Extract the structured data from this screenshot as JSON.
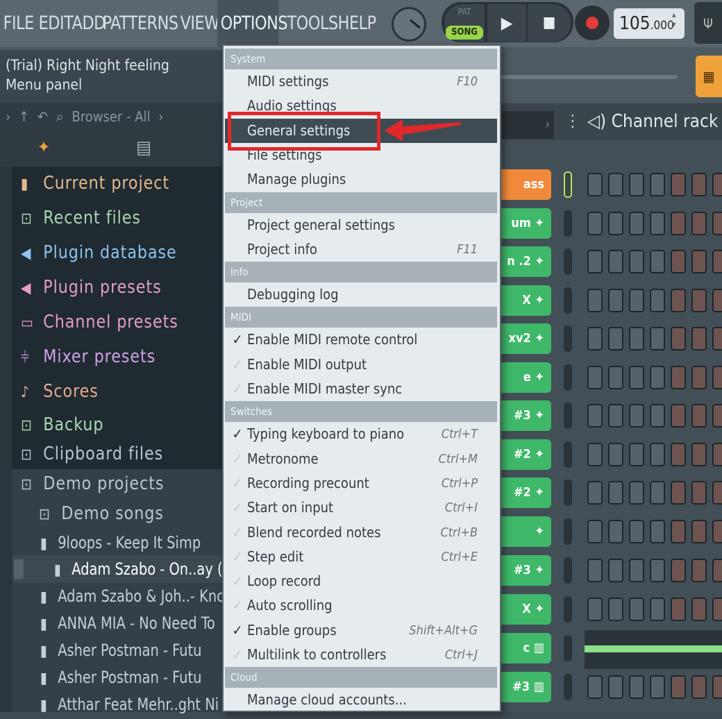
{
  "menubar": {
    "items": [
      "FILE",
      "EDIT",
      "ADD",
      "PATTERNS",
      "VIEW",
      "OPTIONS",
      "TOOLS",
      "HELP"
    ],
    "active": "OPTIONS"
  },
  "transport": {
    "pat_label": "PAT",
    "song_label": "SONG",
    "play_icon": "▶",
    "stop_icon": "■",
    "tempo_main": "105",
    "tempo_frac": ".000"
  },
  "hint": {
    "line1": "(Trial) Right Night feeling",
    "line2": "Menu panel"
  },
  "browser": {
    "toolbar_label": "Browser - All",
    "items": [
      {
        "label": "Current project",
        "icon": "page-icon",
        "color": "#e4b98b"
      },
      {
        "label": "Recent files",
        "icon": "folder-icon",
        "color": "#a9d7b0"
      },
      {
        "label": "Plugin database",
        "icon": "speaker-icon",
        "color": "#8ec3ee"
      },
      {
        "label": "Plugin presets",
        "icon": "speaker-icon",
        "color": "#e59fc4"
      },
      {
        "label": "Channel presets",
        "icon": "channel-icon",
        "color": "#e59fc4"
      },
      {
        "label": "Mixer presets",
        "icon": "mixer-icon",
        "color": "#d0a0e6"
      },
      {
        "label": "Scores",
        "icon": "note-icon",
        "color": "#e7a88e"
      },
      {
        "label": "Backup",
        "icon": "folder-icon",
        "color": "#a9d7b0"
      },
      {
        "label": "Clipboard files",
        "icon": "folder-icon",
        "color": "#b7c6d0"
      },
      {
        "label": "Demo projects",
        "icon": "folder-icon",
        "color": "#b7c6d0"
      },
      {
        "label": "Demo songs",
        "icon": "folder-icon",
        "color": "#b7c6d0"
      }
    ],
    "files": [
      "9loops - Keep It Simp",
      "Adam Szabo - On..ay (",
      "Adam Szabo & Joh..- Knc",
      "ANNA MIA - No Need To",
      "Asher Postman - Futu",
      "Asher Postman - Futu",
      "Atthar Feat Mehr..ght Ni"
    ]
  },
  "channel_rack": {
    "title": "Channel rack",
    "channels": [
      {
        "label": "ass FM",
        "color": "#f08a3a"
      },
      {
        "label": "um",
        "color": "#3fb86a"
      },
      {
        "label": "n .2",
        "color": "#3fb86a"
      },
      {
        "label": "X",
        "color": "#3fb86a"
      },
      {
        "label": "xv2",
        "color": "#3fb86a"
      },
      {
        "label": "e",
        "color": "#3fb86a"
      },
      {
        "label": "#3",
        "color": "#3fb86a"
      },
      {
        "label": "#2",
        "color": "#3fb86a"
      },
      {
        "label": "#2",
        "color": "#3fb86a"
      },
      {
        "label": "",
        "color": "#3fb86a"
      },
      {
        "label": "#3",
        "color": "#3fb86a"
      },
      {
        "label": "X",
        "color": "#3fb86a"
      },
      {
        "label": "c",
        "color": "#3fb86a"
      },
      {
        "label": "#3",
        "color": "#3fb86a"
      }
    ]
  },
  "options_menu": {
    "sections": [
      {
        "header": "System",
        "items": [
          {
            "label": "MIDI settings",
            "shortcut": "F10",
            "check": "none"
          },
          {
            "label": "Audio settings",
            "shortcut": "",
            "check": "none"
          },
          {
            "label": "General settings",
            "shortcut": "",
            "check": "none",
            "highlighted": true
          },
          {
            "label": "File settings",
            "shortcut": "",
            "check": "none"
          },
          {
            "label": "Manage plugins",
            "shortcut": "",
            "check": "none"
          }
        ]
      },
      {
        "header": "Project",
        "items": [
          {
            "label": "Project general settings",
            "shortcut": "",
            "check": "none"
          },
          {
            "label": "Project info",
            "shortcut": "F11",
            "check": "none"
          }
        ]
      },
      {
        "header": "Info",
        "items": [
          {
            "label": "Debugging log",
            "shortcut": "",
            "check": "none"
          }
        ]
      },
      {
        "header": "MIDI",
        "items": [
          {
            "label": "Enable MIDI remote control",
            "shortcut": "",
            "check": "on"
          },
          {
            "label": "Enable MIDI output",
            "shortcut": "",
            "check": "off"
          },
          {
            "label": "Enable MIDI master sync",
            "shortcut": "",
            "check": "off"
          }
        ]
      },
      {
        "header": "Switches",
        "items": [
          {
            "label": "Typing keyboard to piano",
            "shortcut": "Ctrl+T",
            "check": "on"
          },
          {
            "label": "Metronome",
            "shortcut": "Ctrl+M",
            "check": "off"
          },
          {
            "label": "Recording precount",
            "shortcut": "Ctrl+P",
            "check": "off"
          },
          {
            "label": "Start on input",
            "shortcut": "Ctrl+I",
            "check": "off"
          },
          {
            "label": "Blend recorded notes",
            "shortcut": "Ctrl+B",
            "check": "off"
          },
          {
            "label": "Step edit",
            "shortcut": "Ctrl+E",
            "check": "off"
          },
          {
            "label": "Loop record",
            "shortcut": "",
            "check": "off"
          },
          {
            "label": "Auto scrolling",
            "shortcut": "",
            "check": "off"
          },
          {
            "label": "Enable groups",
            "shortcut": "Shift+Alt+G",
            "check": "on"
          },
          {
            "label": "Multilink to controllers",
            "shortcut": "Ctrl+J",
            "check": "off"
          }
        ]
      },
      {
        "header": "Cloud",
        "items": [
          {
            "label": "Manage cloud accounts...",
            "shortcut": "",
            "check": "none"
          }
        ]
      }
    ]
  },
  "annotation": {
    "box_color": "#e0282b"
  }
}
